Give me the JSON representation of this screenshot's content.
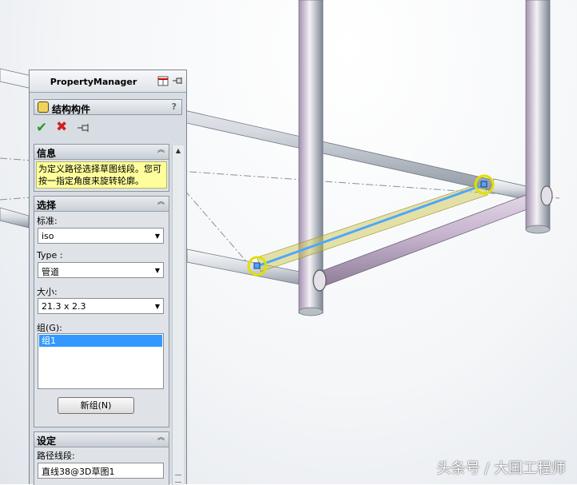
{
  "property_manager": {
    "title": "PropertyManager",
    "feature_title": "结构构件",
    "help_label": "?",
    "ok_icon": "check-icon",
    "cancel_icon": "close-icon",
    "pin_icon": "pushpin-icon",
    "groups": {
      "info": {
        "title": "信息",
        "message": "为定义路径选择草图线段。您可按一指定角度来旋转轮廓。"
      },
      "selection": {
        "title": "选择",
        "standard_label": "标准:",
        "standard_value": "iso",
        "type_label": "Type :",
        "type_value": "管道",
        "size_label": "大小:",
        "size_value": "21.3 x 2.3",
        "group_label": "组(G):",
        "group_items": [
          "组1"
        ],
        "new_group_button": "新组(N)"
      },
      "settings": {
        "title": "设定",
        "path_label": "路径线段:",
        "path_value": "直线38@3D草图1"
      }
    }
  },
  "watermark": "头条号 / 大国工程师",
  "colors": {
    "selected_line": "#4da6ff",
    "highlight": "#d4d400",
    "tube": "#cfd3d9",
    "tube_dark": "#a992b2",
    "list_selection": "#3399ff",
    "info_bg": "#fefe9c"
  }
}
